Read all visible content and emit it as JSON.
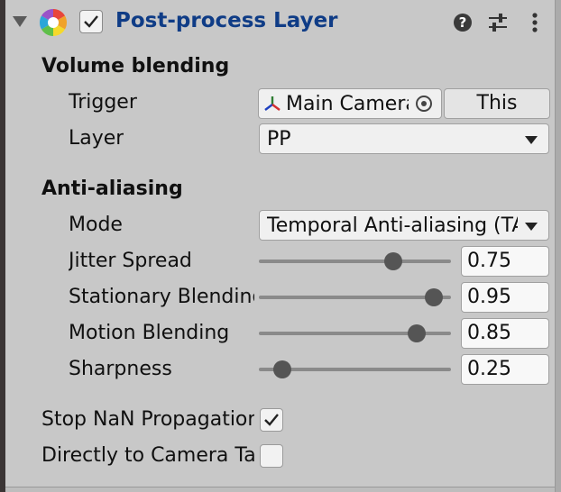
{
  "header": {
    "title": "Post-process Layer",
    "enabled": true
  },
  "volume_blending": {
    "heading": "Volume blending",
    "trigger": {
      "label": "Trigger",
      "value": "Main Camera",
      "button": "This"
    },
    "layer": {
      "label": "Layer",
      "value": "PP"
    }
  },
  "anti_aliasing": {
    "heading": "Anti-aliasing",
    "mode": {
      "label": "Mode",
      "value": "Temporal Anti-aliasing (TAA)"
    },
    "sliders": [
      {
        "label": "Jitter Spread",
        "value": "0.75",
        "fraction": 0.7
      },
      {
        "label": "Stationary Blending",
        "value": "0.95",
        "fraction": 0.91
      },
      {
        "label": "Motion Blending",
        "value": "0.85",
        "fraction": 0.82
      },
      {
        "label": "Sharpness",
        "value": "0.25",
        "fraction": 0.12
      }
    ]
  },
  "stop_nan": {
    "label": "Stop NaN Propagation",
    "checked": true
  },
  "direct_to_target": {
    "label": "Directly to Camera Target",
    "checked": false
  },
  "icons": {
    "foldout": "triangle-down",
    "component": "color-wheel",
    "help": "question-circle",
    "presets": "sliders",
    "menu": "kebab-vertical",
    "object_picker": "target-circle",
    "camera": "transform-gizmo"
  },
  "colors": {
    "background": "#c8c8c8",
    "title": "#0f3c86"
  }
}
